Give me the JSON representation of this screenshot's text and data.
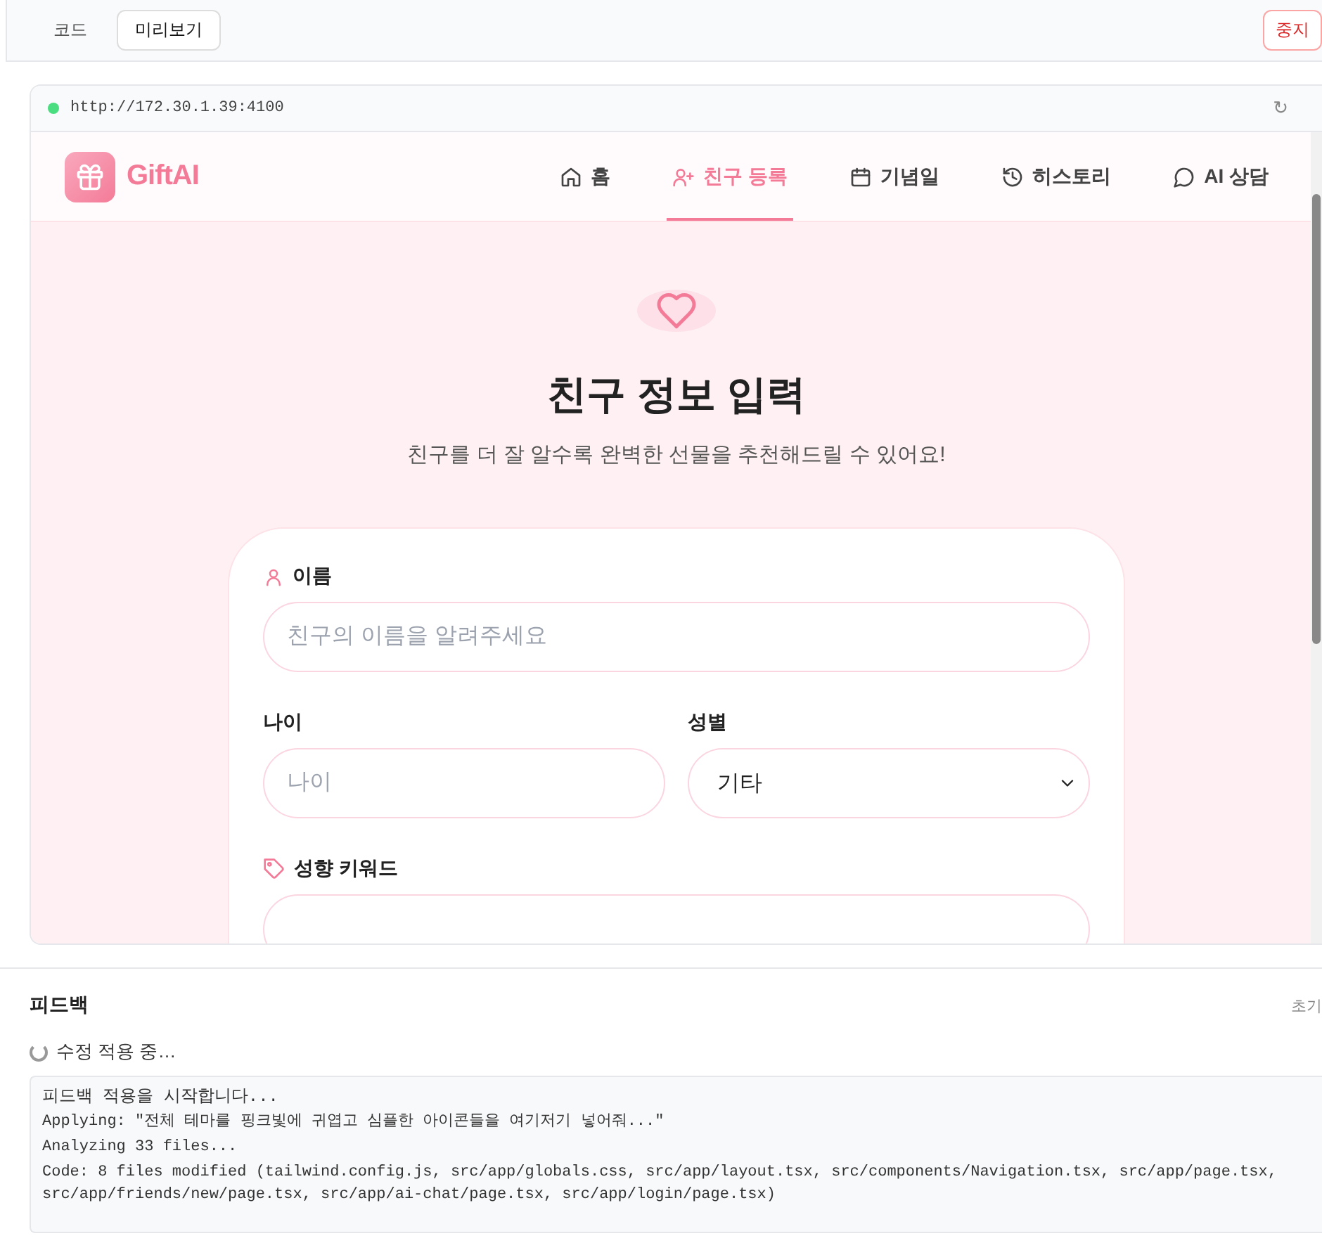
{
  "toolbar": {
    "tabs": [
      {
        "label": "코드",
        "selected": false
      },
      {
        "label": "미리보기",
        "selected": true
      }
    ],
    "stop_button": "중지"
  },
  "preview": {
    "url": "http://172.30.1.39:4100",
    "reload": "↻",
    "brand": "GiftAI",
    "nav": [
      {
        "label": "홈",
        "selected": false
      },
      {
        "label": "친구 등록",
        "selected": true
      },
      {
        "label": "기념일",
        "selected": false
      },
      {
        "label": "히스토리",
        "selected": false
      },
      {
        "label": "AI 상담",
        "selected": false
      }
    ],
    "hero": {
      "title": "친구 정보 입력",
      "subtitle": "친구를 더 잘 알수록 완벽한 선물을 추천해드릴 수 있어요!"
    },
    "form": {
      "name": {
        "label": "이름",
        "placeholder": "친구의 이름을 알려주세요"
      },
      "age": {
        "label": "나이",
        "placeholder": "나이"
      },
      "gender": {
        "label": "성별",
        "value": "기타"
      },
      "keywords": {
        "label": "성향 키워드"
      }
    }
  },
  "feedback": {
    "title": "피드백",
    "reset": "초기",
    "status": "수정 적용 중…",
    "log": [
      "피드백 적용을 시작합니다...",
      "Applying: \"전체 테마를 핑크빛에 귀엽고 심플한 아이콘들을 여기저기 넣어줘...\"",
      "Analyzing 33 files...",
      "Code: 8 files modified (tailwind.config.js, src/app/globals.css, src/app/layout.tsx, src/components/Navigation.tsx, src/app/page.tsx, src/app/friends/new/page.tsx, src/app/ai-chat/page.tsx, src/app/login/page.tsx)"
    ]
  }
}
